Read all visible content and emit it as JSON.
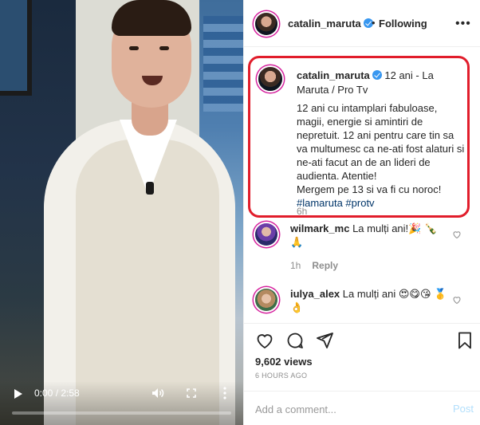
{
  "video": {
    "current_time": "0:00",
    "duration": "2:58",
    "time_display": "0:00 / 2:58",
    "progress": 0,
    "icons": [
      "play-icon",
      "volume-icon",
      "fullscreen-icon",
      "more-vertical-icon"
    ]
  },
  "header": {
    "username": "catalin_maruta",
    "separator": "•",
    "following_label": "Following",
    "options_icon": "•••"
  },
  "caption": {
    "username": "catalin_maruta",
    "meta": " 12 ani - La Maruta / Pro Tv",
    "text": "12 ani cu intamplari fabuloase, magii, energie si amintiri de nepretuit. 12 ani pentru care tin sa va multumesc ca ne-ati fost alaturi si ne-ati facut an de an lideri de audienta. Atentie!\nMergem pe 13 si va fi cu noroc!",
    "hashtags": "#lamaruta #protv",
    "time": "6h",
    "highlight_color": "#e11d2b"
  },
  "comments": [
    {
      "username": "wilmark_mc",
      "text": "La mulți ani!🎉 🍾 🙏",
      "time": "1h",
      "reply_label": "Reply"
    },
    {
      "username": "iulya_alex",
      "text": "La mulți ani 😍😋😘 🥇👌",
      "time": "",
      "reply_label": ""
    }
  ],
  "actions": {
    "icons": [
      "heart-icon",
      "comment-icon",
      "share-icon",
      "bookmark-icon"
    ]
  },
  "stats": {
    "views": "9,602 views",
    "posted": "6 HOURS AGO"
  },
  "add_comment": {
    "placeholder": "Add a comment...",
    "post_label": "Post"
  },
  "colors": {
    "verified": "#3897f0",
    "hashtag": "#003569",
    "muted": "#8e8e8e",
    "post_disabled": "#b2dffc"
  }
}
